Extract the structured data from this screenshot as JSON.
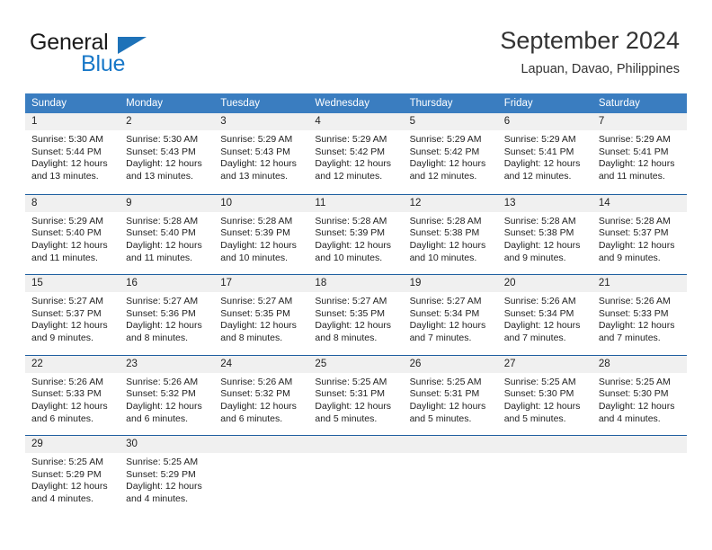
{
  "brand": {
    "line1": "General",
    "line2": "Blue",
    "logo_icon": "triangle-flag-icon",
    "accent_color": "#1e72b8"
  },
  "header": {
    "title": "September 2024",
    "location": "Lapuan, Davao, Philippines"
  },
  "calendar": {
    "header_color": "#3a7dc0",
    "weekdays": [
      "Sunday",
      "Monday",
      "Tuesday",
      "Wednesday",
      "Thursday",
      "Friday",
      "Saturday"
    ],
    "weeks": [
      [
        {
          "day": "1",
          "sunrise": "Sunrise: 5:30 AM",
          "sunset": "Sunset: 5:44 PM",
          "daylight1": "Daylight: 12 hours",
          "daylight2": "and 13 minutes."
        },
        {
          "day": "2",
          "sunrise": "Sunrise: 5:30 AM",
          "sunset": "Sunset: 5:43 PM",
          "daylight1": "Daylight: 12 hours",
          "daylight2": "and 13 minutes."
        },
        {
          "day": "3",
          "sunrise": "Sunrise: 5:29 AM",
          "sunset": "Sunset: 5:43 PM",
          "daylight1": "Daylight: 12 hours",
          "daylight2": "and 13 minutes."
        },
        {
          "day": "4",
          "sunrise": "Sunrise: 5:29 AM",
          "sunset": "Sunset: 5:42 PM",
          "daylight1": "Daylight: 12 hours",
          "daylight2": "and 12 minutes."
        },
        {
          "day": "5",
          "sunrise": "Sunrise: 5:29 AM",
          "sunset": "Sunset: 5:42 PM",
          "daylight1": "Daylight: 12 hours",
          "daylight2": "and 12 minutes."
        },
        {
          "day": "6",
          "sunrise": "Sunrise: 5:29 AM",
          "sunset": "Sunset: 5:41 PM",
          "daylight1": "Daylight: 12 hours",
          "daylight2": "and 12 minutes."
        },
        {
          "day": "7",
          "sunrise": "Sunrise: 5:29 AM",
          "sunset": "Sunset: 5:41 PM",
          "daylight1": "Daylight: 12 hours",
          "daylight2": "and 11 minutes."
        }
      ],
      [
        {
          "day": "8",
          "sunrise": "Sunrise: 5:29 AM",
          "sunset": "Sunset: 5:40 PM",
          "daylight1": "Daylight: 12 hours",
          "daylight2": "and 11 minutes."
        },
        {
          "day": "9",
          "sunrise": "Sunrise: 5:28 AM",
          "sunset": "Sunset: 5:40 PM",
          "daylight1": "Daylight: 12 hours",
          "daylight2": "and 11 minutes."
        },
        {
          "day": "10",
          "sunrise": "Sunrise: 5:28 AM",
          "sunset": "Sunset: 5:39 PM",
          "daylight1": "Daylight: 12 hours",
          "daylight2": "and 10 minutes."
        },
        {
          "day": "11",
          "sunrise": "Sunrise: 5:28 AM",
          "sunset": "Sunset: 5:39 PM",
          "daylight1": "Daylight: 12 hours",
          "daylight2": "and 10 minutes."
        },
        {
          "day": "12",
          "sunrise": "Sunrise: 5:28 AM",
          "sunset": "Sunset: 5:38 PM",
          "daylight1": "Daylight: 12 hours",
          "daylight2": "and 10 minutes."
        },
        {
          "day": "13",
          "sunrise": "Sunrise: 5:28 AM",
          "sunset": "Sunset: 5:38 PM",
          "daylight1": "Daylight: 12 hours",
          "daylight2": "and 9 minutes."
        },
        {
          "day": "14",
          "sunrise": "Sunrise: 5:28 AM",
          "sunset": "Sunset: 5:37 PM",
          "daylight1": "Daylight: 12 hours",
          "daylight2": "and 9 minutes."
        }
      ],
      [
        {
          "day": "15",
          "sunrise": "Sunrise: 5:27 AM",
          "sunset": "Sunset: 5:37 PM",
          "daylight1": "Daylight: 12 hours",
          "daylight2": "and 9 minutes."
        },
        {
          "day": "16",
          "sunrise": "Sunrise: 5:27 AM",
          "sunset": "Sunset: 5:36 PM",
          "daylight1": "Daylight: 12 hours",
          "daylight2": "and 8 minutes."
        },
        {
          "day": "17",
          "sunrise": "Sunrise: 5:27 AM",
          "sunset": "Sunset: 5:35 PM",
          "daylight1": "Daylight: 12 hours",
          "daylight2": "and 8 minutes."
        },
        {
          "day": "18",
          "sunrise": "Sunrise: 5:27 AM",
          "sunset": "Sunset: 5:35 PM",
          "daylight1": "Daylight: 12 hours",
          "daylight2": "and 8 minutes."
        },
        {
          "day": "19",
          "sunrise": "Sunrise: 5:27 AM",
          "sunset": "Sunset: 5:34 PM",
          "daylight1": "Daylight: 12 hours",
          "daylight2": "and 7 minutes."
        },
        {
          "day": "20",
          "sunrise": "Sunrise: 5:26 AM",
          "sunset": "Sunset: 5:34 PM",
          "daylight1": "Daylight: 12 hours",
          "daylight2": "and 7 minutes."
        },
        {
          "day": "21",
          "sunrise": "Sunrise: 5:26 AM",
          "sunset": "Sunset: 5:33 PM",
          "daylight1": "Daylight: 12 hours",
          "daylight2": "and 7 minutes."
        }
      ],
      [
        {
          "day": "22",
          "sunrise": "Sunrise: 5:26 AM",
          "sunset": "Sunset: 5:33 PM",
          "daylight1": "Daylight: 12 hours",
          "daylight2": "and 6 minutes."
        },
        {
          "day": "23",
          "sunrise": "Sunrise: 5:26 AM",
          "sunset": "Sunset: 5:32 PM",
          "daylight1": "Daylight: 12 hours",
          "daylight2": "and 6 minutes."
        },
        {
          "day": "24",
          "sunrise": "Sunrise: 5:26 AM",
          "sunset": "Sunset: 5:32 PM",
          "daylight1": "Daylight: 12 hours",
          "daylight2": "and 6 minutes."
        },
        {
          "day": "25",
          "sunrise": "Sunrise: 5:25 AM",
          "sunset": "Sunset: 5:31 PM",
          "daylight1": "Daylight: 12 hours",
          "daylight2": "and 5 minutes."
        },
        {
          "day": "26",
          "sunrise": "Sunrise: 5:25 AM",
          "sunset": "Sunset: 5:31 PM",
          "daylight1": "Daylight: 12 hours",
          "daylight2": "and 5 minutes."
        },
        {
          "day": "27",
          "sunrise": "Sunrise: 5:25 AM",
          "sunset": "Sunset: 5:30 PM",
          "daylight1": "Daylight: 12 hours",
          "daylight2": "and 5 minutes."
        },
        {
          "day": "28",
          "sunrise": "Sunrise: 5:25 AM",
          "sunset": "Sunset: 5:30 PM",
          "daylight1": "Daylight: 12 hours",
          "daylight2": "and 4 minutes."
        }
      ],
      [
        {
          "day": "29",
          "sunrise": "Sunrise: 5:25 AM",
          "sunset": "Sunset: 5:29 PM",
          "daylight1": "Daylight: 12 hours",
          "daylight2": "and 4 minutes."
        },
        {
          "day": "30",
          "sunrise": "Sunrise: 5:25 AM",
          "sunset": "Sunset: 5:29 PM",
          "daylight1": "Daylight: 12 hours",
          "daylight2": "and 4 minutes."
        },
        {
          "day": "",
          "sunrise": "",
          "sunset": "",
          "daylight1": "",
          "daylight2": ""
        },
        {
          "day": "",
          "sunrise": "",
          "sunset": "",
          "daylight1": "",
          "daylight2": ""
        },
        {
          "day": "",
          "sunrise": "",
          "sunset": "",
          "daylight1": "",
          "daylight2": ""
        },
        {
          "day": "",
          "sunrise": "",
          "sunset": "",
          "daylight1": "",
          "daylight2": ""
        },
        {
          "day": "",
          "sunrise": "",
          "sunset": "",
          "daylight1": "",
          "daylight2": ""
        }
      ]
    ]
  }
}
